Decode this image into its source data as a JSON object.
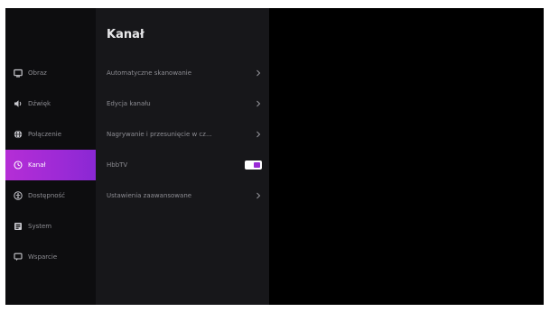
{
  "sidebar": {
    "items": [
      {
        "label": "Obraz",
        "icon": "picture-icon",
        "active": false
      },
      {
        "label": "Dźwięk",
        "icon": "sound-icon",
        "active": false
      },
      {
        "label": "Połączenie",
        "icon": "connection-icon",
        "active": false
      },
      {
        "label": "Kanał",
        "icon": "channel-icon",
        "active": true
      },
      {
        "label": "Dostępność",
        "icon": "accessibility-icon",
        "active": false
      },
      {
        "label": "System",
        "icon": "system-icon",
        "active": false
      },
      {
        "label": "Wsparcie",
        "icon": "support-icon",
        "active": false
      }
    ]
  },
  "panel": {
    "title": "Kanał",
    "items": [
      {
        "label": "Automatyczne skanowanie",
        "type": "link",
        "icon": "chevron-right-icon"
      },
      {
        "label": "Edycja kanału",
        "type": "link",
        "icon": "chevron-right-icon"
      },
      {
        "label": "Nagrywanie i przesunięcie w cz...",
        "type": "link",
        "icon": "chevron-right-icon"
      },
      {
        "label": "HbbTV",
        "type": "toggle",
        "state": "on"
      },
      {
        "label": "Ustawienia zaawansowane",
        "type": "link",
        "icon": "chevron-right-icon"
      }
    ]
  },
  "colors": {
    "accent": "#a02bd6",
    "background": "#000000",
    "sidebar": "#0d0d0f",
    "panel": "#17171a",
    "text_dim": "#8d8d93",
    "text_bright": "#e8e8ea"
  }
}
